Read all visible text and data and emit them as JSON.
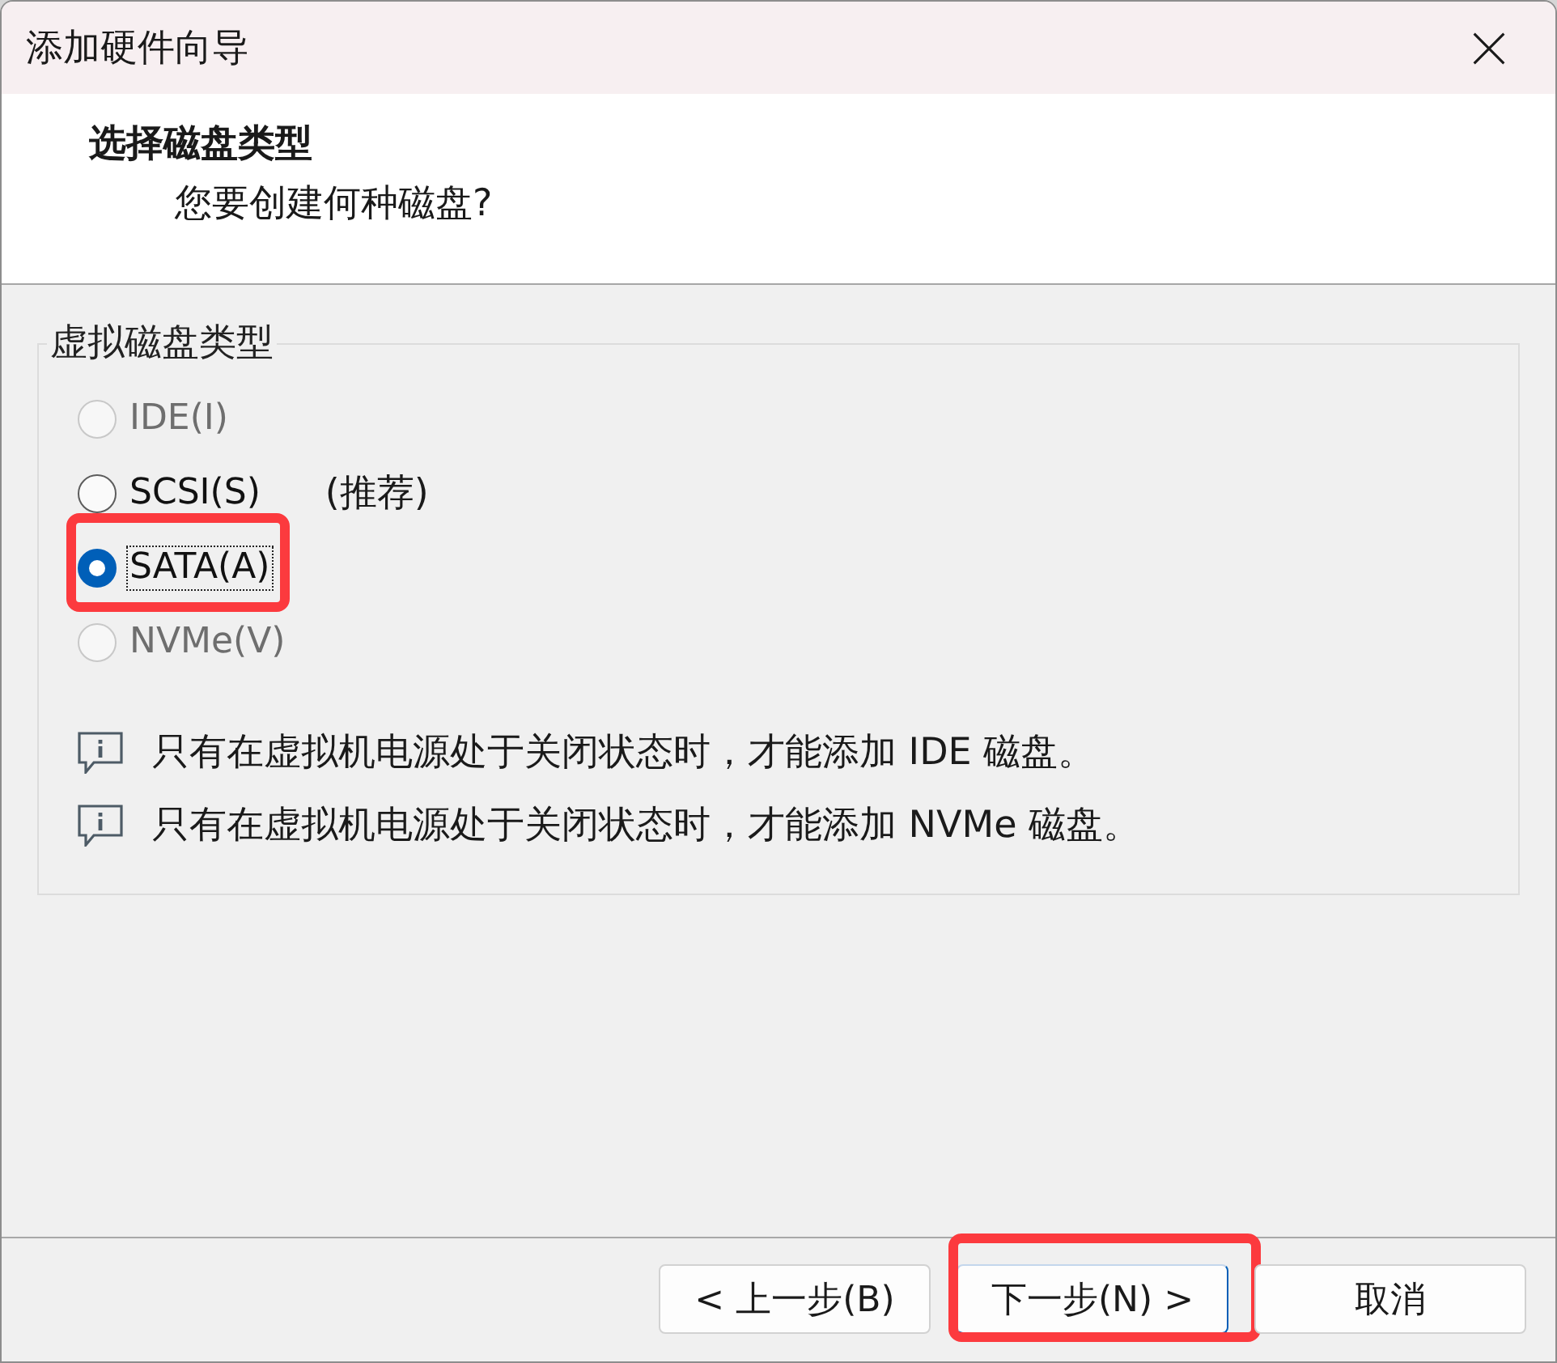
{
  "window": {
    "title": "添加硬件向导"
  },
  "header": {
    "title": "选择磁盘类型",
    "subtitle": "您要创建何种磁盘?"
  },
  "disk_type_group": {
    "label": "虚拟磁盘类型",
    "options": [
      {
        "label": "IDE(I)",
        "selected": false,
        "disabled": true,
        "focused": false,
        "highlighted": false
      },
      {
        "label": "SCSI(S)",
        "note": "(推荐)",
        "selected": false,
        "disabled": false,
        "focused": false,
        "highlighted": false
      },
      {
        "label": "SATA(A)",
        "selected": true,
        "disabled": false,
        "focused": true,
        "highlighted": true
      },
      {
        "label": "NVMe(V)",
        "selected": false,
        "disabled": true,
        "focused": false,
        "highlighted": false
      }
    ],
    "notes": [
      "只有在虚拟机电源处于关闭状态时，才能添加 IDE 磁盘。",
      "只有在虚拟机电源处于关闭状态时，才能添加 NVMe 磁盘。"
    ]
  },
  "buttons": [
    {
      "label": "< 上一步(B)",
      "default": false,
      "highlighted": false
    },
    {
      "label": "下一步(N) >",
      "default": true,
      "highlighted": true
    },
    {
      "label": "取消",
      "default": false,
      "highlighted": false
    }
  ]
}
